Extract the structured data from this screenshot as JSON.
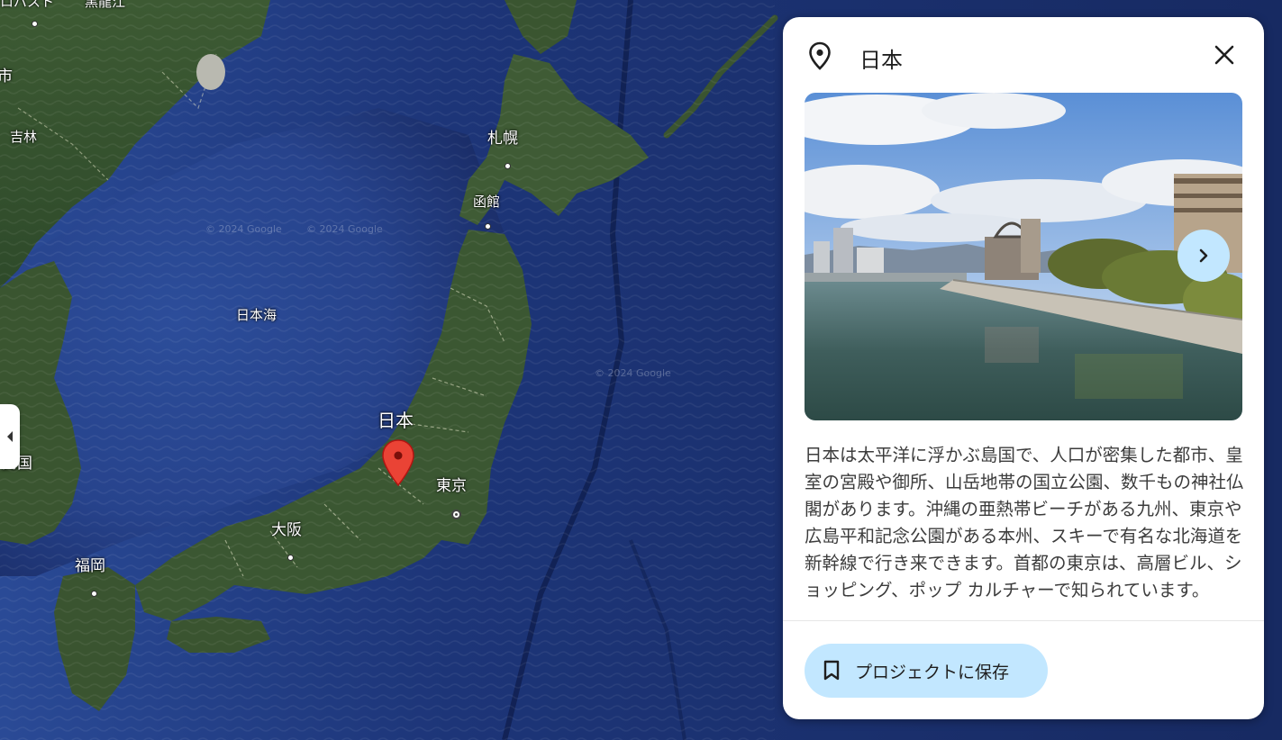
{
  "map": {
    "labels": {
      "sapporo": "札幌",
      "hakodate": "函館",
      "sea_of_japan": "日本海",
      "nihon": "日本",
      "tokyo": "東京",
      "osaka": "大阪",
      "fukuoka": "福岡",
      "jilin": "吉林",
      "korea_partial": "民国",
      "city_partial_left": "市",
      "top_fragment_1": "ロバスト",
      "top_fragment_2": "黒龍江"
    },
    "watermarks": [
      "© 2024 Google",
      "© 2024 Google",
      "© 2024 Google"
    ],
    "marker_icon": "red-map-pin-icon",
    "collapse_tab_icon": "triangle-left-icon"
  },
  "panel": {
    "title": "日本",
    "place_icon": "location-pin-icon",
    "close_icon": "close-icon",
    "next_icon": "chevron-right-icon",
    "description": "日本は太平洋に浮かぶ島国で、人口が密集した都市、皇室の宮殿や御所、山岳地帯の国立公園、数千もの神社仏閣があります。沖縄の亜熱帯ビーチがある九州、東京や広島平和記念公園がある本州、スキーで有名な北海道を新幹線で行き来できます。首都の東京は、高層ビル、ショッピング、ポップ カルチャーで知られています。",
    "save_button": {
      "label": "プロジェクトに保存",
      "icon": "bookmark-icon"
    }
  },
  "colors": {
    "accent_button": "#c2e7ff",
    "marker": "#ea4335",
    "deep_ocean": "#1b2f6b"
  }
}
